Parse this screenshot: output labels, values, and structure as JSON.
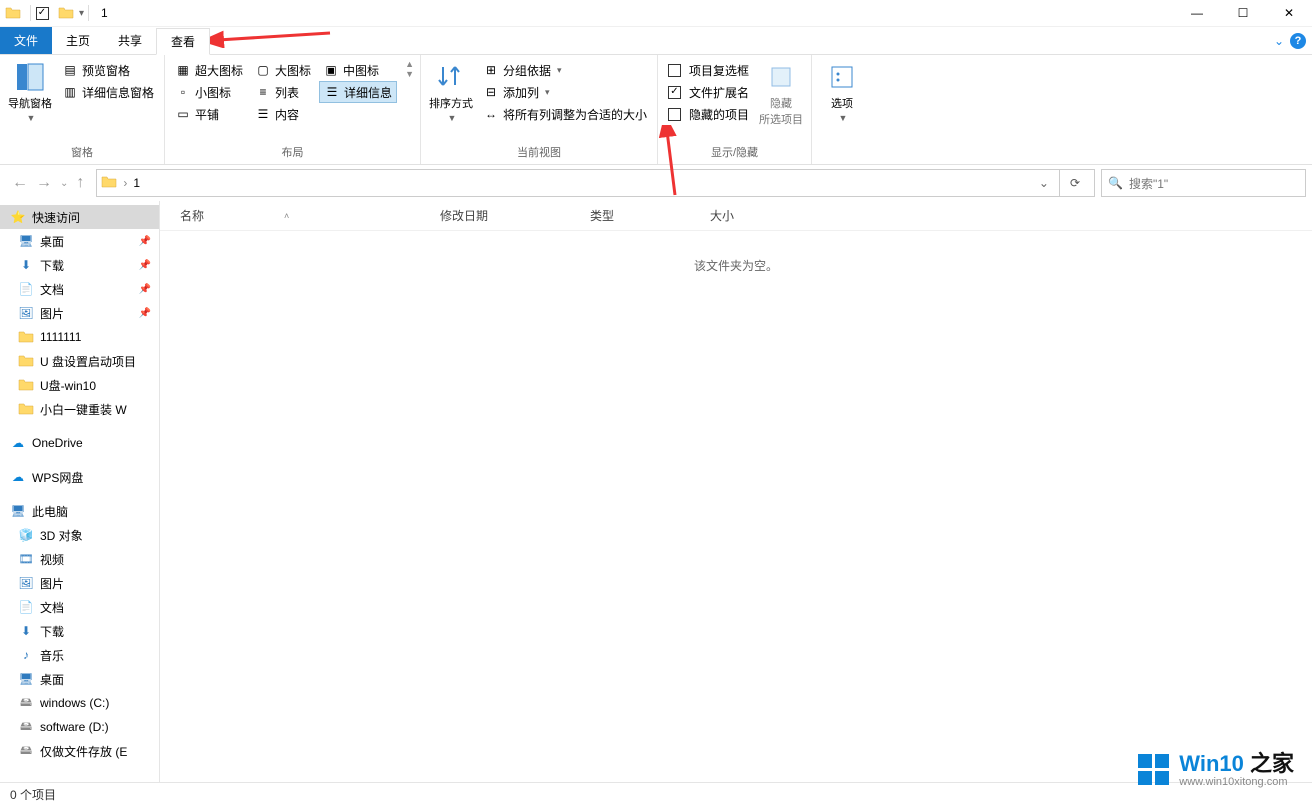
{
  "title": "1",
  "tabs": {
    "file": "文件",
    "home": "主页",
    "share": "共享",
    "view": "查看"
  },
  "ribbon": {
    "panes": {
      "label": "窗格",
      "nav_pane": "导航窗格",
      "preview_pane": "预览窗格",
      "details_pane": "详细信息窗格"
    },
    "layout": {
      "label": "布局",
      "extra_large": "超大图标",
      "large": "大图标",
      "medium": "中图标",
      "small": "小图标",
      "list": "列表",
      "details": "详细信息",
      "tiles": "平铺",
      "content": "内容"
    },
    "current_view": {
      "label": "当前视图",
      "sort_by": "排序方式",
      "group_by": "分组依据",
      "add_columns": "添加列",
      "size_all": "将所有列调整为合适的大小"
    },
    "show_hide": {
      "label": "显示/隐藏",
      "item_checkboxes": "项目复选框",
      "file_ext": "文件扩展名",
      "hidden_items": "隐藏的项目",
      "hide_selected": "隐藏\n所选项目"
    },
    "options": "选项"
  },
  "address": {
    "path": "1"
  },
  "search": {
    "placeholder": "搜索\"1\""
  },
  "columns": {
    "name": "名称",
    "date": "修改日期",
    "type": "类型",
    "size": "大小"
  },
  "empty_message": "该文件夹为空。",
  "sidebar": {
    "quick_access": "快速访问",
    "pinned": [
      {
        "label": "桌面",
        "icon": "desktop"
      },
      {
        "label": "下载",
        "icon": "download"
      },
      {
        "label": "文档",
        "icon": "document"
      },
      {
        "label": "图片",
        "icon": "pictures"
      }
    ],
    "recent_folders": [
      "1111111",
      "U 盘设置启动项目",
      "U盘-win10",
      "小白一键重装 W"
    ],
    "onedrive": "OneDrive",
    "wps": "WPS网盘",
    "this_pc": "此电脑",
    "pc_items": [
      {
        "label": "3D 对象",
        "icon": "3d"
      },
      {
        "label": "视频",
        "icon": "video"
      },
      {
        "label": "图片",
        "icon": "pictures"
      },
      {
        "label": "文档",
        "icon": "document"
      },
      {
        "label": "下载",
        "icon": "download"
      },
      {
        "label": "音乐",
        "icon": "music"
      },
      {
        "label": "桌面",
        "icon": "desktop"
      },
      {
        "label": "windows (C:)",
        "icon": "drive"
      },
      {
        "label": "software (D:)",
        "icon": "drive"
      },
      {
        "label": "仅做文件存放 (E",
        "icon": "drive"
      }
    ]
  },
  "status": "0 个项目",
  "watermark": {
    "brand": "Win10",
    "suffix": "之家",
    "url": "www.win10xitong.com"
  }
}
